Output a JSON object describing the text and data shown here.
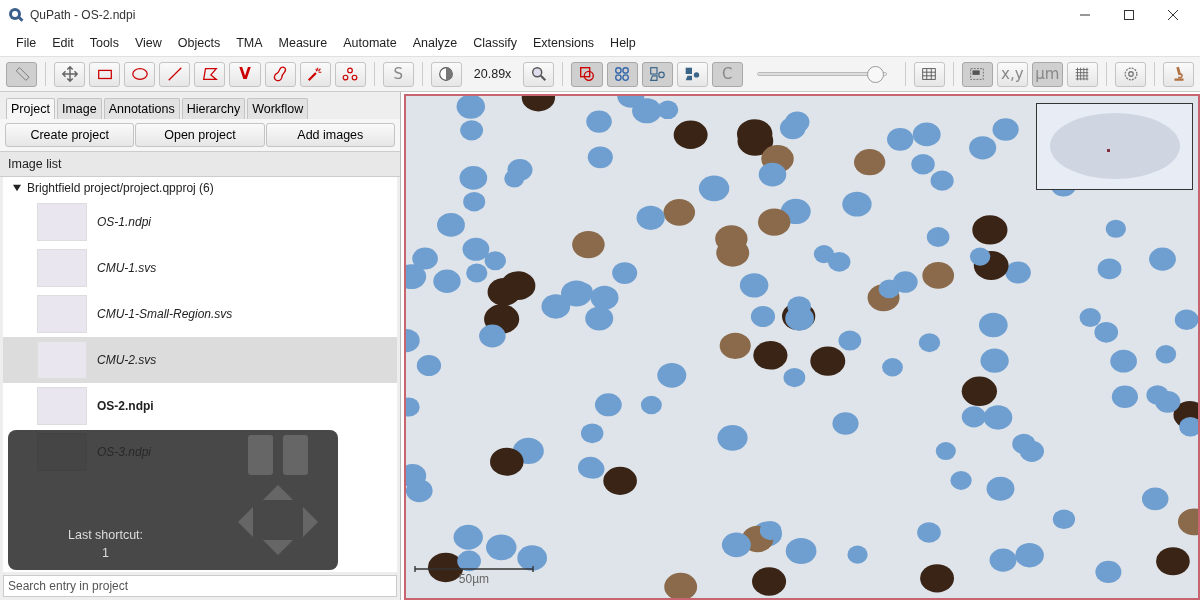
{
  "window": {
    "title": "QuPath - OS-2.ndpi"
  },
  "menu": [
    "File",
    "Edit",
    "Tools",
    "View",
    "Objects",
    "TMA",
    "Measure",
    "Automate",
    "Analyze",
    "Classify",
    "Extensions",
    "Help"
  ],
  "toolbar": [
    [
      {
        "kind": "ruler",
        "selected": true
      }
    ],
    [
      {
        "kind": "move",
        "selected": false
      },
      {
        "kind": "rectangle",
        "selected": false
      },
      {
        "kind": "ellipse",
        "selected": false
      },
      {
        "kind": "line",
        "selected": false
      },
      {
        "kind": "polygon",
        "selected": false
      },
      {
        "kind": "glyph",
        "label": "V",
        "selected": false
      },
      {
        "kind": "brush",
        "selected": false
      },
      {
        "kind": "wand",
        "selected": false
      },
      {
        "kind": "points",
        "selected": false
      }
    ],
    [
      {
        "kind": "glyph",
        "label": "S",
        "selected": false
      }
    ],
    [
      {
        "kind": "contrast",
        "selected": false
      },
      {
        "kind": "readout",
        "label": "20.89x"
      },
      {
        "kind": "magnifier",
        "selected": false
      }
    ],
    [
      {
        "kind": "annotations",
        "selected": true
      },
      {
        "kind": "tma",
        "selected": true
      },
      {
        "kind": "detections",
        "selected": true
      },
      {
        "kind": "fill",
        "selected": false
      },
      {
        "kind": "glyph",
        "label": "C",
        "selected": true
      },
      {
        "kind": "slider",
        "level": 0.98
      }
    ],
    [
      {
        "kind": "table",
        "selected": false
      }
    ],
    [
      {
        "kind": "overview",
        "selected": true
      },
      {
        "kind": "glyph",
        "label": "x,y",
        "selected": false
      },
      {
        "kind": "glyph",
        "label": "µm",
        "selected": true
      },
      {
        "kind": "grid",
        "selected": false
      }
    ],
    [
      {
        "kind": "settings",
        "selected": false
      }
    ],
    [
      {
        "kind": "microscope",
        "selected": false
      }
    ]
  ],
  "tabs": [
    {
      "label": "Project",
      "selected": true
    },
    {
      "label": "Image",
      "selected": false
    },
    {
      "label": "Annotations",
      "selected": false
    },
    {
      "label": "Hierarchy",
      "selected": false
    },
    {
      "label": "Workflow",
      "selected": false
    }
  ],
  "project_buttons": [
    "Create project",
    "Open project",
    "Add images"
  ],
  "image_list": {
    "header": "Image list",
    "root": {
      "label": "Brightfield project/project.qpproj (6)",
      "expanded": true,
      "children": [
        {
          "name": "OS-1.ndpi",
          "open": false,
          "selected": false
        },
        {
          "name": "CMU-1.svs",
          "open": false,
          "selected": false
        },
        {
          "name": "CMU-1-Small-Region.svs",
          "open": false,
          "selected": false
        },
        {
          "name": "CMU-2.svs",
          "open": false,
          "selected": true
        },
        {
          "name": "OS-2.ndpi",
          "open": true,
          "selected": false
        },
        {
          "name": "OS-3.ndpi",
          "open": false,
          "selected": false
        }
      ]
    }
  },
  "search": {
    "placeholder": "Search entry in project"
  },
  "shortcut_overlay": {
    "label": "Last shortcut:",
    "key": "1"
  },
  "viewer": {
    "scale_bar": "50µm"
  }
}
